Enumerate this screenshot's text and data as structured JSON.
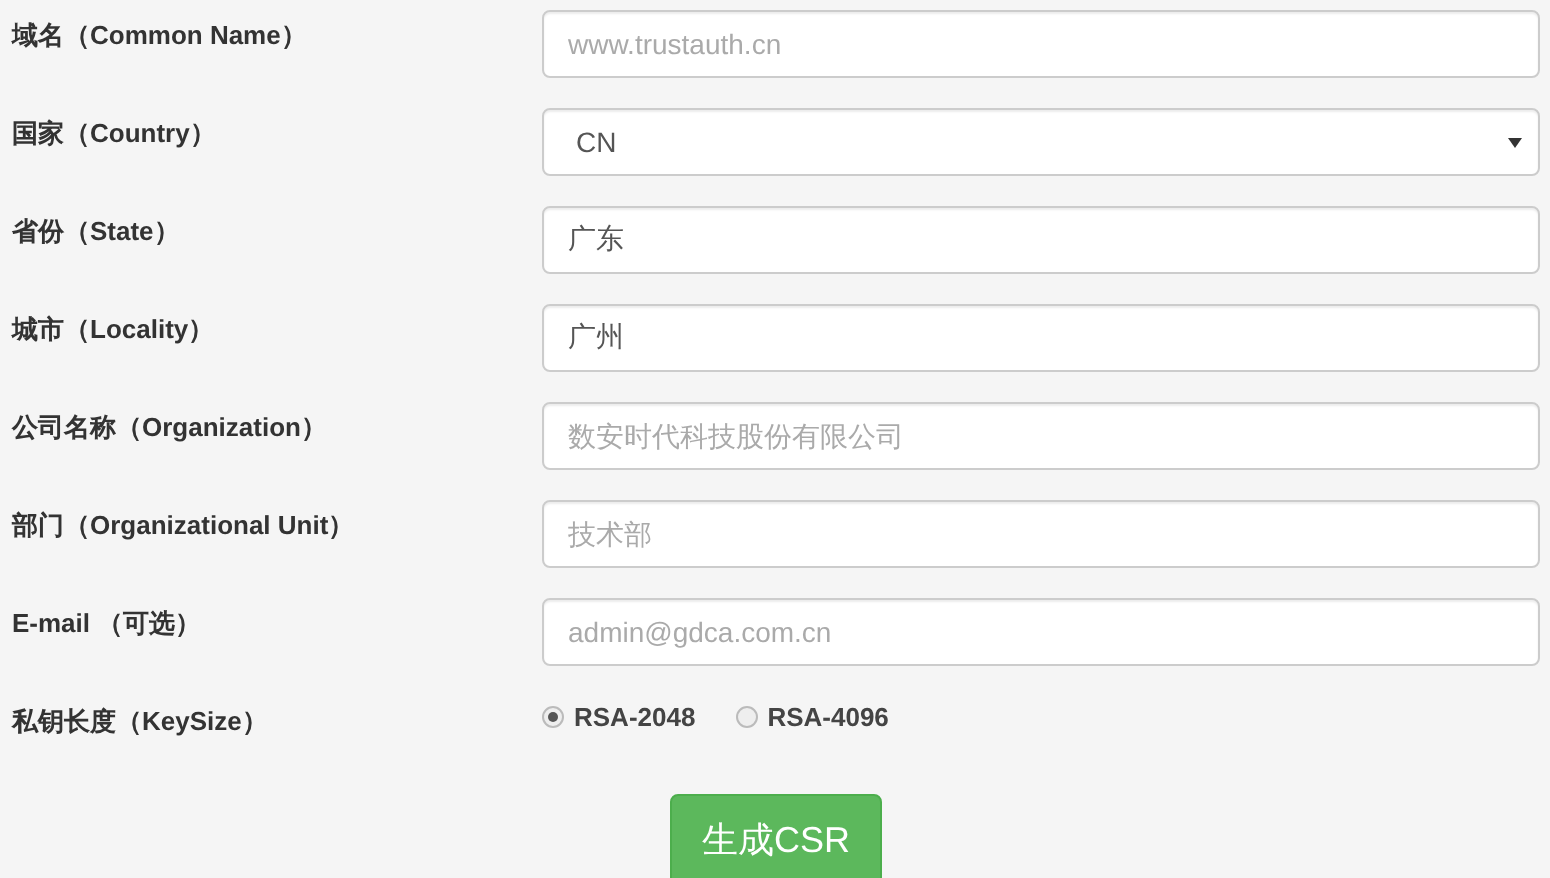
{
  "fields": [
    {
      "kind": "text",
      "label": "域名（Common Name）",
      "placeholder": "www.trustauth.cn"
    },
    {
      "kind": "select",
      "label": "国家（Country）",
      "value": "CN"
    },
    {
      "kind": "text",
      "label": "省份（State）",
      "value": "广东"
    },
    {
      "kind": "text",
      "label": "城市（Locality）",
      "value": "广州"
    },
    {
      "kind": "text",
      "label": "公司名称（Organization）",
      "placeholder": "数安时代科技股份有限公司"
    },
    {
      "kind": "text",
      "label": "部门（Organizational Unit）",
      "placeholder": "技术部"
    },
    {
      "kind": "text",
      "label": "E-mail （可选）",
      "placeholder": "admin@gdca.com.cn"
    }
  ],
  "key_size": {
    "label": "私钥长度（KeySize）",
    "options": [
      {
        "label": "RSA-2048",
        "selected": true
      },
      {
        "label": "RSA-4096",
        "selected": false
      }
    ]
  },
  "submit_button": "生成CSR"
}
